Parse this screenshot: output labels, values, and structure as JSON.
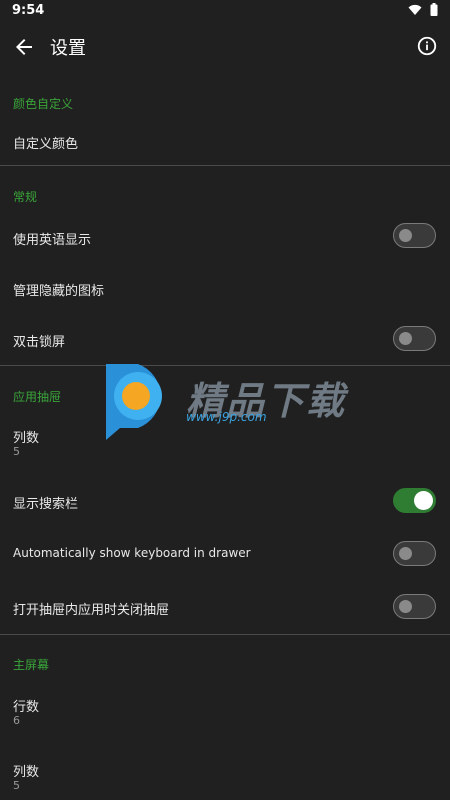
{
  "status_bar": {
    "time": "9:54",
    "icons": [
      "wifi-icon",
      "battery-icon"
    ]
  },
  "app_bar": {
    "title": "设置"
  },
  "sections": {
    "color": {
      "header": "颜色自定义",
      "custom_color": "自定义颜色"
    },
    "general": {
      "header": "常规",
      "english_display": {
        "label": "使用英语显示",
        "on": false
      },
      "manage_hidden_icons": "管理隐藏的图标",
      "double_tap_lock": {
        "label": "双击锁屏",
        "on": false
      }
    },
    "drawer": {
      "header": "应用抽屉",
      "columns": {
        "label": "列数",
        "value": "5"
      },
      "show_search_bar": {
        "label": "显示搜索栏",
        "on": true
      },
      "auto_keyboard": {
        "label": "Automatically show keyboard in drawer",
        "on": false
      },
      "close_on_open": {
        "label": "打开抽屉内应用时关闭抽屉",
        "on": false
      }
    },
    "home": {
      "header": "主屏幕",
      "rows": {
        "label": "行数",
        "value": "6"
      },
      "columns": {
        "label": "列数",
        "value": "5"
      }
    }
  },
  "watermark": {
    "title": "精品下载",
    "url": "www.j9p.com"
  },
  "colors": {
    "accent": "#3aa53a",
    "background": "#202020",
    "toggle_on": "#2e7d32"
  }
}
